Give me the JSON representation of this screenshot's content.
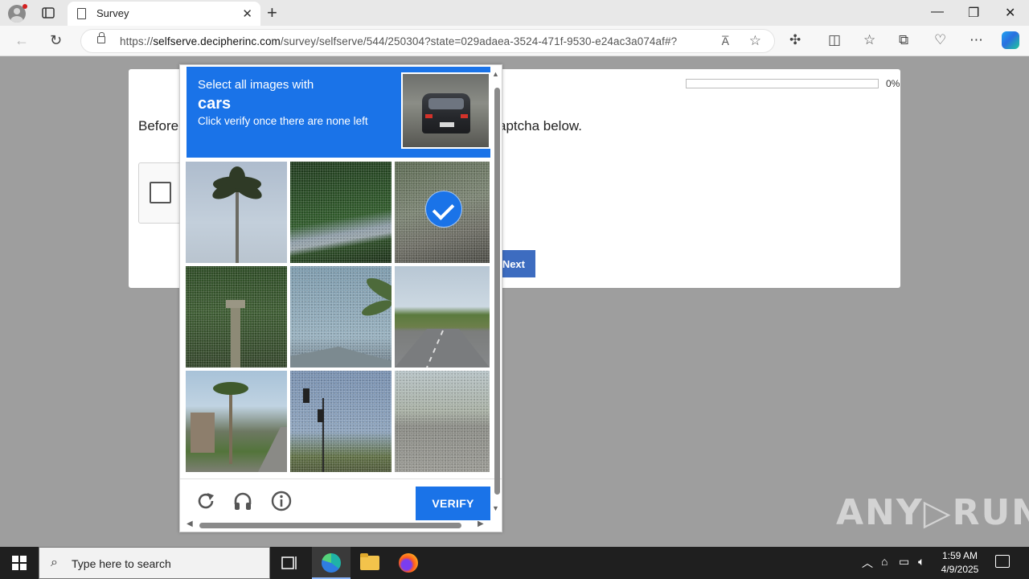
{
  "browser": {
    "tab_title": "Survey",
    "url_prefix": "https://",
    "url_host": "selfserve.decipherinc.com",
    "url_path": "/survey/selfserve/544/250304?state=029adaea-3524-471f-9530-e24ac3a074af#?",
    "read_aloud_label": "A̅"
  },
  "survey": {
    "progress_percent": 0,
    "progress_label": "0%",
    "prompt_left": "Before",
    "prompt_right": "aptcha below.",
    "next_label": "Next"
  },
  "captcha": {
    "line1": "Select all images with",
    "target": "cars",
    "line3": "Click verify once there are none left",
    "verify_label": "VERIFY",
    "selected_tiles": [
      2
    ],
    "tiles": [
      {
        "name": "palm-tree-sky"
      },
      {
        "name": "hedge-wall"
      },
      {
        "name": "roadside-wall"
      },
      {
        "name": "tree-lamppost"
      },
      {
        "name": "palm-roofline"
      },
      {
        "name": "road-trees"
      },
      {
        "name": "street-palms"
      },
      {
        "name": "traffic-light-trees"
      },
      {
        "name": "wide-road"
      }
    ]
  },
  "watermark": "ANY▷RUN",
  "taskbar": {
    "search_placeholder": "Type here to search",
    "time": "1:59 AM",
    "date": "4/9/2025"
  },
  "colors": {
    "captcha_blue": "#1a73e8",
    "next_blue": "#3d6cc0"
  }
}
